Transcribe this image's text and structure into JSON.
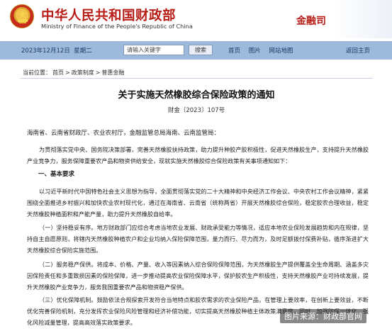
{
  "header": {
    "title_cn": "中华人民共和国财政部",
    "title_en": "Ministry of Finance of the People's Republic of China",
    "dept": "金融司"
  },
  "navbar": {
    "date": "2023年12月12日",
    "weekday": "星期二",
    "search_placeholder": "请输入关键字",
    "search_button": "搜索",
    "links": [
      "首页",
      "图片",
      "网站地图"
    ],
    "back": "返回主页"
  },
  "breadcrumb": {
    "prefix": "当前位置：",
    "items": [
      "首页",
      "政策制度",
      "普惠金融"
    ],
    "separator": ">"
  },
  "document": {
    "title": "关于实施天然橡胶综合保险政策的通知",
    "number": "财金〔2023〕107号",
    "addressee": "海南省、云南省财政厅、农业农村厅，金融监管总局海南、云南监管局：",
    "intro": "为贯彻落实党中央、国务院决策部署，完善天然橡胶扶持政策，助力提升种胶产胶积极性，促进天然橡胶生产，支持提升天然橡胶产业竞争力，服务保障重要农产品和物资供给安全，现就实施天然橡胶综合保险政策有关事项通知如下：",
    "section1_head": "一、基本要求",
    "section1_text": "以习近平新时代中国特色社会主义思想为指导，全面贯彻落实党的二十大精神和中央经济工作会议、中央农村工作会议精神，紧紧围绕全面推进乡村振兴和加快农业农村现代化，通过在海南省、云南省（统称两省）开展天然橡胶综合保险，稳定胶农合理收益，稳定天然橡胶种植面积和产能产量，助力提升天然橡胶自给率。",
    "item1": "（一）坚持稳妥有序。地方财政部门应综合考虑当地农业发展、财政承受能力等情况，适应本地农业保险发展趋势和内在规律，坚持自主自愿原则，将辖内天然橡胶种植农户和企业均纳入保险保障范围，量力而行、尽力而为，及时足额拨付保费补贴，循序渐进扩大天然橡胶综合保险实施范围。",
    "item2": "（二）服务稳产保供。将成本、价格、产量、收入等因素纳入综合保险保障范围，为天然橡胶生产提供覆盖全生命周期、涵盖多灾因保险责任和多重致损因素的保险保障，进一步推动提高农业保险保障水平，保护胶农生产积极性，支持天然橡胶产业可持续发展，提升天然橡胶产业竞争力，服务我国重要农产品和物资稳产保供。",
    "item3": "（三）优化保障机制。鼓励依法合规探索开发符合当地特点和胶农需求的农业保险产品，在管理上要效率，在创新上要效益，不断优化完善保险机制，充分发挥农业保险风险管理和经济补偿功能，切实提高天然橡胶种植主体政策满意度。同时，加强防保一体化，强化风险减量管理，提高高效落实政策要求。"
  },
  "watermark": "图片来源：财政部官网"
}
